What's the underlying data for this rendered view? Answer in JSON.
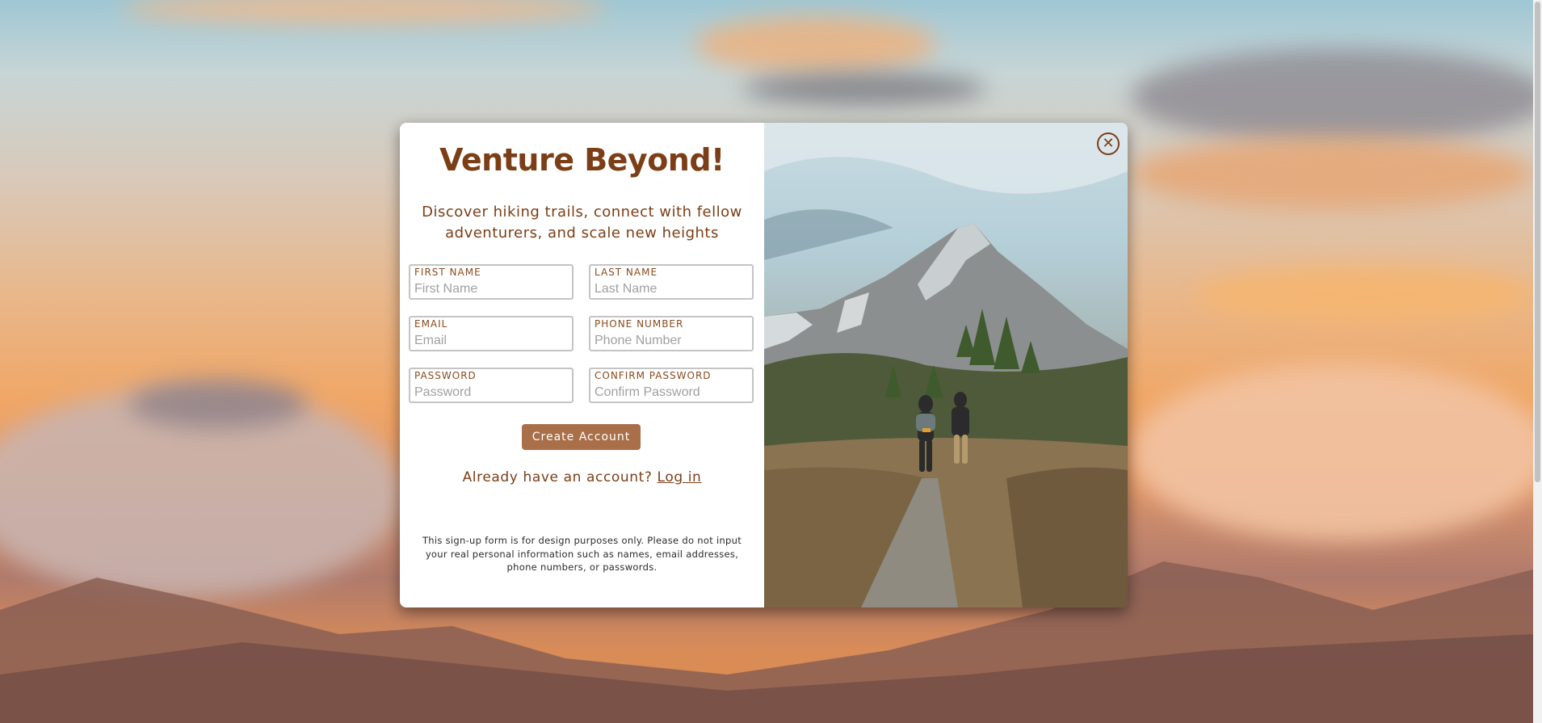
{
  "modal": {
    "title": "Venture Beyond!",
    "subtitle": "Discover hiking trails, connect with fellow adventurers, and scale new heights",
    "fields": [
      {
        "label": "FIRST NAME",
        "placeholder": "First Name"
      },
      {
        "label": "LAST NAME",
        "placeholder": "Last Name"
      },
      {
        "label": "EMAIL",
        "placeholder": "Email"
      },
      {
        "label": "PHONE NUMBER",
        "placeholder": "Phone Number"
      },
      {
        "label": "PASSWORD",
        "placeholder": "Password"
      },
      {
        "label": "CONFIRM PASSWORD",
        "placeholder": "Confirm Password"
      }
    ],
    "create_button": "Create Account",
    "login_prompt": "Already have an account?",
    "login_link": "Log in",
    "disclaimer": "This sign-up form is for design purposes only. Please do not input your real personal information such as names, email addresses, phone numbers, or passwords.",
    "close_icon": "close-icon"
  },
  "colors": {
    "brand_brown": "#7b3e17",
    "button_bg": "#a96f49",
    "field_border": "#c4c4c4"
  }
}
